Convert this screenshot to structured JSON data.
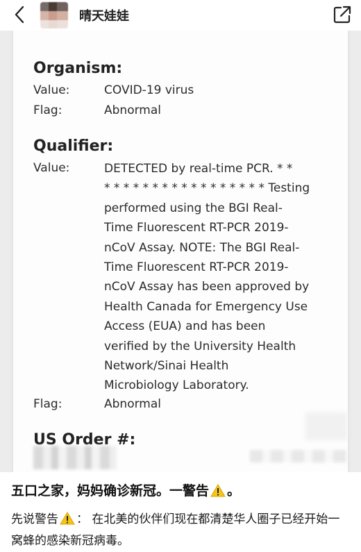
{
  "header": {
    "username": "晴天娃娃",
    "back_icon": "chevron-left-icon",
    "share_icon": "external-share-icon"
  },
  "document": {
    "organism": {
      "title": "Organism:",
      "value_label": "Value:",
      "value": "COVID-19 virus",
      "flag_label": "Flag:",
      "flag": "Abnormal"
    },
    "qualifier": {
      "title": "Qualifier:",
      "value_label": "Value:",
      "value_lines": [
        "DETECTED by real-time PCR. * *",
        "* * * * * * * * * * * * * * * * * Testing",
        "performed using the BGI Real-",
        "Time Fluorescent RT-PCR 2019-",
        "nCoV Assay. NOTE: The BGI Real-",
        "Time Fluorescent RT-PCR 2019-",
        "nCoV Assay has been approved by",
        "Health Canada for Emergency Use",
        "Access (EUA) and has been",
        "verified by the University Health",
        "Network/Sinai Health",
        "Microbiology Laboratory."
      ],
      "flag_label": "Flag:",
      "flag": "Abnormal"
    },
    "us_order": {
      "title": "US Order #:"
    }
  },
  "post": {
    "caption_before": "五口之家，妈妈确诊新冠。一警告",
    "caption_after": "。",
    "body_before": "先说警告",
    "body_after": "：  在北美的伙伴们现在都清楚华人圈子已经开始一窝蜂的感染新冠病毒。",
    "warning_icon": "warning-emoji-icon",
    "warning_color": "#f5c518"
  }
}
